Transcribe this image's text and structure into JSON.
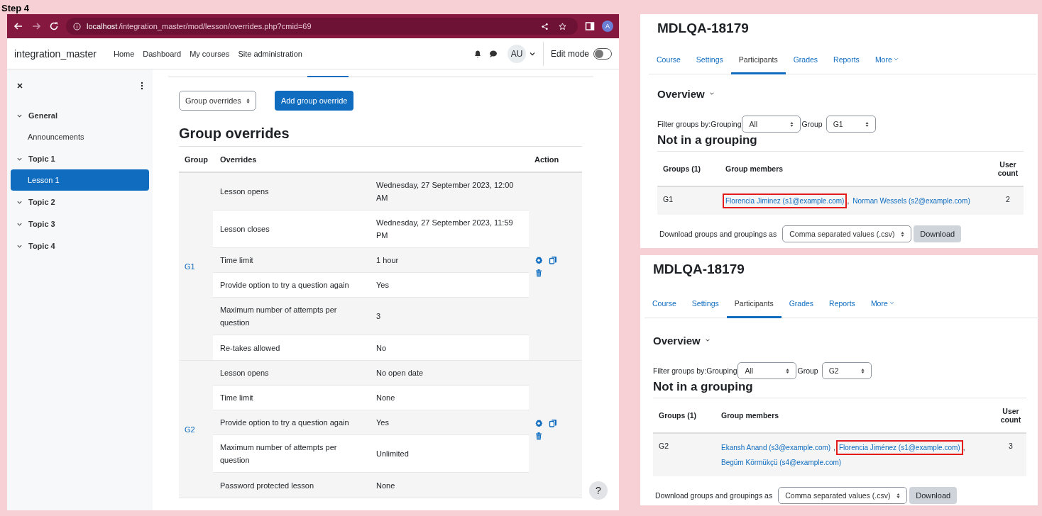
{
  "step_label": "Step 4",
  "browser": {
    "url_host": "localhost",
    "url_path": "/integration_master/mod/lesson/overrides.php?cmid=69",
    "profile_initial": "A"
  },
  "navbar": {
    "site_name": "integration_master",
    "links": [
      "Home",
      "Dashboard",
      "My courses",
      "Site administration"
    ],
    "user_initials": "AU",
    "edit_mode": {
      "label": "Edit mode",
      "on": false
    }
  },
  "sidebar": {
    "items": [
      {
        "label": "General",
        "expanded": true,
        "children": [
          {
            "label": "Announcements",
            "selected": false
          }
        ]
      },
      {
        "label": "Topic 1",
        "expanded": true,
        "children": [
          {
            "label": "Lesson 1",
            "selected": true
          }
        ]
      },
      {
        "label": "Topic 2",
        "expanded": true
      },
      {
        "label": "Topic 3",
        "expanded": true
      },
      {
        "label": "Topic 4",
        "expanded": true
      }
    ]
  },
  "main": {
    "override_select": "Group overrides",
    "add_button": "Add group override",
    "heading": "Group overrides",
    "columns": [
      "Group",
      "Overrides",
      "Action"
    ],
    "groups": [
      {
        "name": "G1",
        "overrides": [
          {
            "setting": "Lesson opens",
            "value": "Wednesday, 27 September 2023, 12:00 AM"
          },
          {
            "setting": "Lesson closes",
            "value": "Wednesday, 27 September 2023, 11:59 PM"
          },
          {
            "setting": "Time limit",
            "value": "1 hour"
          },
          {
            "setting": "Provide option to try a question again",
            "value": "Yes"
          },
          {
            "setting": "Maximum number of attempts per question",
            "value": "3"
          },
          {
            "setting": "Re-takes allowed",
            "value": "No"
          }
        ]
      },
      {
        "name": "G2",
        "overrides": [
          {
            "setting": "Lesson opens",
            "value": "No open date"
          },
          {
            "setting": "Time limit",
            "value": "None"
          },
          {
            "setting": "Provide option to try a question again",
            "value": "Yes"
          },
          {
            "setting": "Maximum number of attempts per question",
            "value": "Unlimited"
          },
          {
            "setting": "Password protected lesson",
            "value": "None"
          }
        ]
      }
    ],
    "help": "?"
  },
  "panels": [
    {
      "title": "MDLQA-18179",
      "tabs": [
        {
          "label": "Course",
          "selected": false
        },
        {
          "label": "Settings",
          "selected": false
        },
        {
          "label": "Participants",
          "selected": true
        },
        {
          "label": "Grades",
          "selected": false
        },
        {
          "label": "Reports",
          "selected": false
        },
        {
          "label": "More",
          "selected": false
        }
      ],
      "overview": "Overview",
      "filter_label": "Filter groups by:Grouping",
      "grouping_value": "All",
      "group_label": "Group",
      "group_value": "G1",
      "heading": "Not in a grouping",
      "columns": [
        "Groups (1)",
        "Group members",
        "User count"
      ],
      "rows": [
        {
          "group": "G1",
          "members": [
            {
              "name": "Florencia Jiminez (s1@example.com)",
              "highlighted": true,
              "separator": ","
            },
            {
              "name": "Norman Wessels (s2@example.com)",
              "highlighted": false
            }
          ],
          "count": "2"
        }
      ],
      "download_label": "Download groups and groupings as",
      "format": "Comma separated values (.csv)",
      "download_button": "Download"
    },
    {
      "title": "MDLQA-18179",
      "tabs": [
        {
          "label": "Course",
          "selected": false
        },
        {
          "label": "Settings",
          "selected": false
        },
        {
          "label": "Participants",
          "selected": true
        },
        {
          "label": "Grades",
          "selected": false
        },
        {
          "label": "Reports",
          "selected": false
        },
        {
          "label": "More",
          "selected": false
        }
      ],
      "overview": "Overview",
      "filter_label": "Filter groups by:Grouping",
      "grouping_value": "All",
      "group_label": "Group",
      "group_value": "G2",
      "heading": "Not in a grouping",
      "columns": [
        "Groups (1)",
        "Group members",
        "User count"
      ],
      "rows": [
        {
          "group": "G2",
          "members": [
            {
              "name": "Ekansh Anand (s3@example.com)",
              "highlighted": false,
              "separator": ","
            },
            {
              "name": "Florencia Jiménez (s1@example.com)",
              "highlighted": true,
              "separator": ","
            },
            {
              "name": "Begüm Körmükçü (s4@example.com)",
              "highlighted": false
            }
          ],
          "count": "3"
        }
      ],
      "download_label": "Download groups and groupings as",
      "format": "Comma separated values (.csv)",
      "download_button": "Download"
    }
  ]
}
